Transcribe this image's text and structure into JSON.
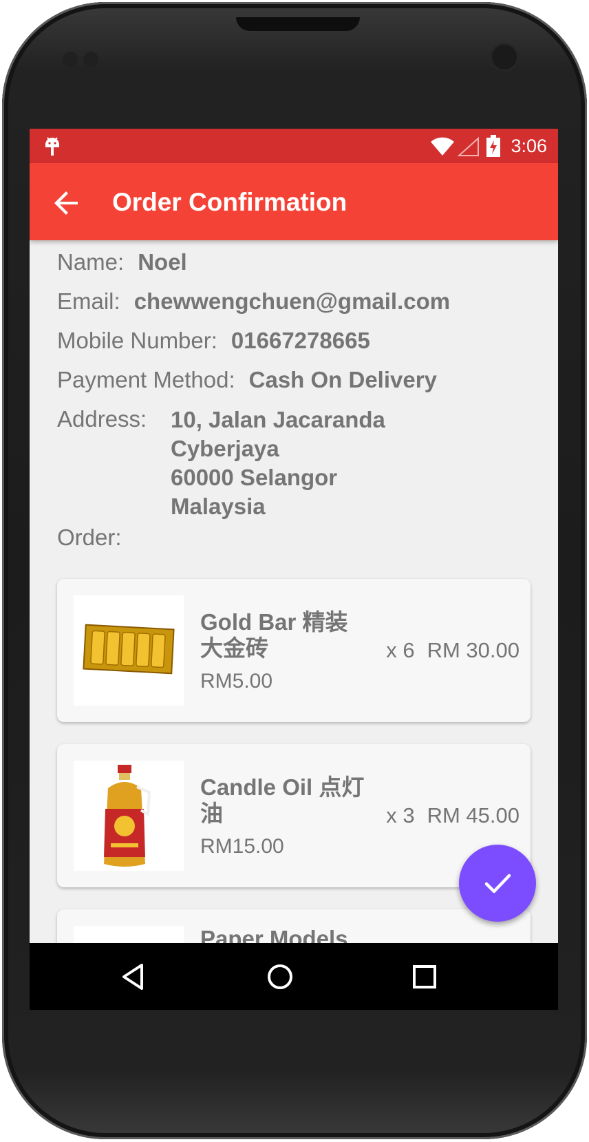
{
  "status_bar": {
    "time": "3:06"
  },
  "app_bar": {
    "title": "Order Confirmation"
  },
  "details": {
    "name_label": "Name:",
    "name_value": "Noel",
    "email_label": "Email:",
    "email_value": "chewwengchuen@gmail.com",
    "mobile_label": "Mobile Number:",
    "mobile_value": "01667278665",
    "payment_label": "Payment Method:",
    "payment_value": "Cash On Delivery",
    "address_label": "Address:",
    "address_lines": [
      "10, Jalan Jacaranda",
      "Cyberjaya",
      "60000 Selangor",
      "Malaysia"
    ],
    "order_label": "Order:"
  },
  "order_items": [
    {
      "name_line1": "Gold Bar 精装",
      "name_line2": "大金砖",
      "unit_price": "RM5.00",
      "quantity": "x 6",
      "total": "RM 30.00",
      "image_icon": "gold-bar-image"
    },
    {
      "name_line1": "Candle Oil 点灯",
      "name_line2": "油",
      "unit_price": "RM15.00",
      "quantity": "x 3",
      "total": "RM 45.00",
      "image_icon": "candle-oil-image"
    },
    {
      "name_line1": "Paper Models",
      "name_line2": "",
      "unit_price": "",
      "quantity": "",
      "total": "",
      "image_icon": "paper-models-image"
    }
  ],
  "colors": {
    "status_bar": "#d32f2f",
    "app_bar": "#f44336",
    "fab": "#7c4dff",
    "text": "#757575"
  }
}
